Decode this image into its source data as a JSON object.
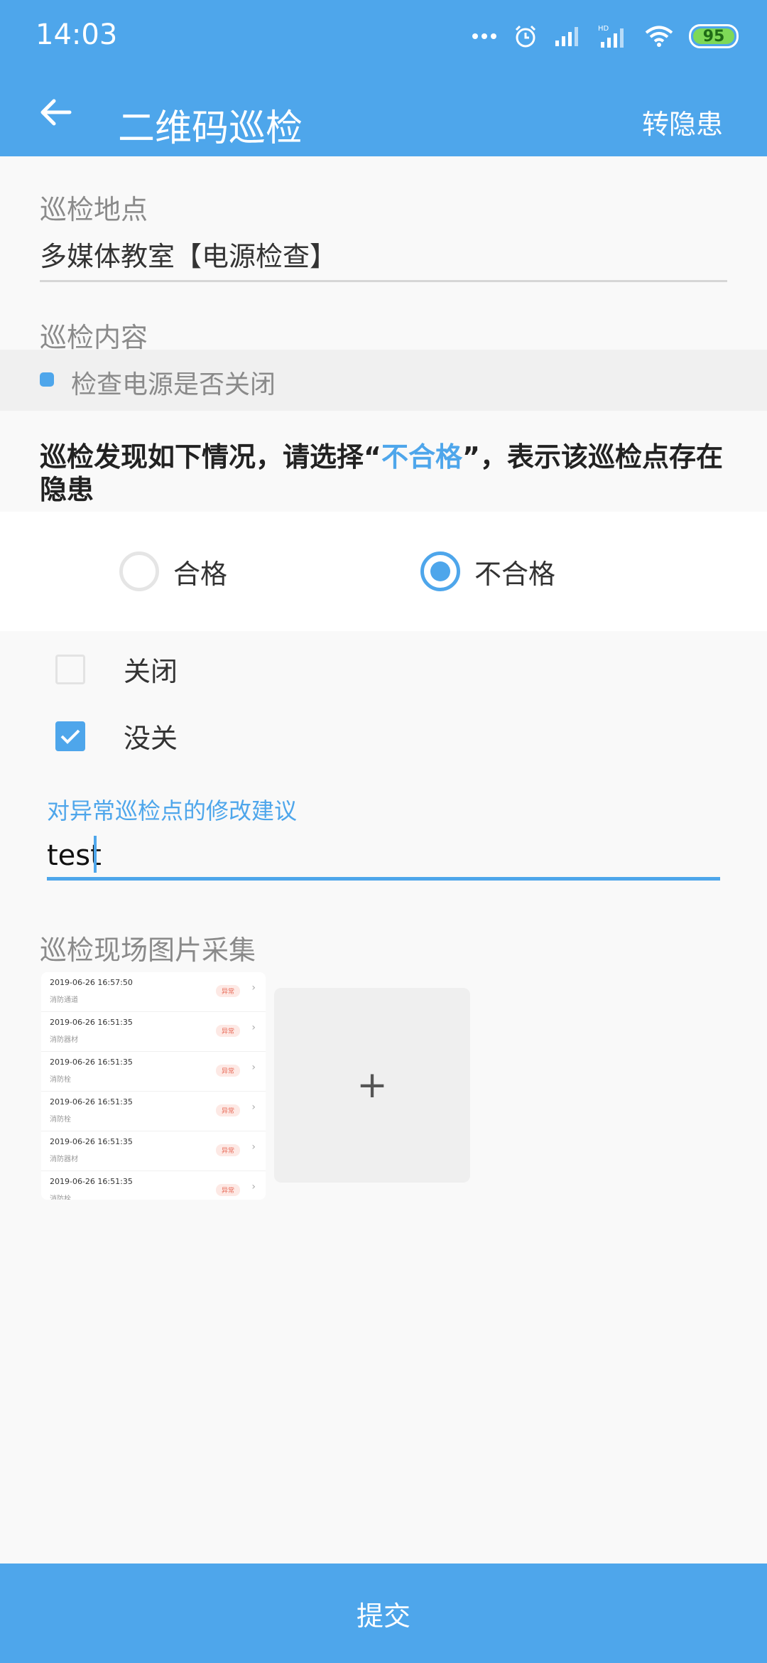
{
  "status": {
    "time": "14:03",
    "battery": "95"
  },
  "toolbar": {
    "title": "二维码巡检",
    "action": "转隐患"
  },
  "location": {
    "label": "巡检地点",
    "value": "多媒体教室【电源检查】"
  },
  "content": {
    "label": "巡检内容",
    "item": "检查电源是否关闭"
  },
  "notice": {
    "before": "巡检发现如下情况，请选择“",
    "highlight": "不合格",
    "after": "”，表示该巡检点存在隐患"
  },
  "options": {
    "pass": "合格",
    "fail": "不合格",
    "selected": "fail"
  },
  "checks": [
    {
      "label": "关闭",
      "checked": false
    },
    {
      "label": "没关",
      "checked": true
    }
  ],
  "advice": {
    "label": "对异常巡检点的修改建议",
    "value": "test"
  },
  "photos": {
    "label": "巡检现场图片采集",
    "add": "+",
    "thumbnail_rows": [
      {
        "date": "2019-06-26 16:57:50",
        "sub": "消防通道",
        "badge": "异常"
      },
      {
        "date": "2019-06-26 16:51:35",
        "sub": "消防器材",
        "badge": "异常"
      },
      {
        "date": "2019-06-26 16:51:35",
        "sub": "消防栓",
        "badge": "异常"
      },
      {
        "date": "2019-06-26 16:51:35",
        "sub": "消防栓",
        "badge": "异常"
      },
      {
        "date": "2019-06-26 16:51:35",
        "sub": "消防器材",
        "badge": "异常"
      },
      {
        "date": "2019-06-26 16:51:35",
        "sub": "消防栓",
        "badge": "异常"
      }
    ]
  },
  "submit": {
    "label": "提交"
  },
  "colors": {
    "accent": "#4ea6eb"
  }
}
